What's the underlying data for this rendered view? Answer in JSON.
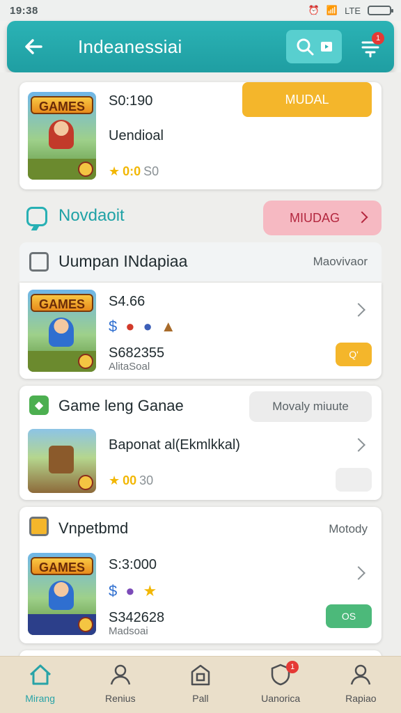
{
  "status_bar": {
    "time": "19:38",
    "network": "LTE"
  },
  "app_bar": {
    "title": "Indeanessiai",
    "notification_count": "1"
  },
  "featured": {
    "thumb_logo": "GAMES",
    "price": "S0:190",
    "name": "Uendioal",
    "rating": "0:0",
    "rating_count": "S0",
    "action_label": "MUDAL"
  },
  "section": {
    "title": "Novdaoit",
    "action_label": "MIUDAG"
  },
  "group": {
    "title": "Uumpan INdapiaa",
    "right_label": "Maovivaor",
    "item": {
      "thumb_logo": "GAMES",
      "price": "S4.66",
      "meta": "S682355",
      "sub": "AlitaSoal",
      "button": "Q'"
    }
  },
  "card2": {
    "title": "Game leng Ganae",
    "pill": "Movaly miuute",
    "item": {
      "thumb_logo": "",
      "name": "Baponat al(Ekmlkkal)",
      "rating": "00",
      "rating_count": "30"
    }
  },
  "card3": {
    "title": "Vnpetbmd",
    "right_label": "Motody",
    "item": {
      "thumb_logo": "GAMES",
      "price": "S:3:000",
      "meta": "S342628",
      "sub": "Madsoai",
      "button": "OS"
    }
  },
  "bottom_nav": {
    "items": [
      {
        "label": "Mirang"
      },
      {
        "label": "Renius"
      },
      {
        "label": "Pall"
      },
      {
        "label": "Uanorica",
        "badge": "1"
      },
      {
        "label": "Rapiao"
      }
    ]
  },
  "colors": {
    "accent": "#22a7ab",
    "orange": "#f4b62b",
    "green": "#4cb97a",
    "pink": "#f6b9c2",
    "nav_bg": "#eadfca"
  }
}
